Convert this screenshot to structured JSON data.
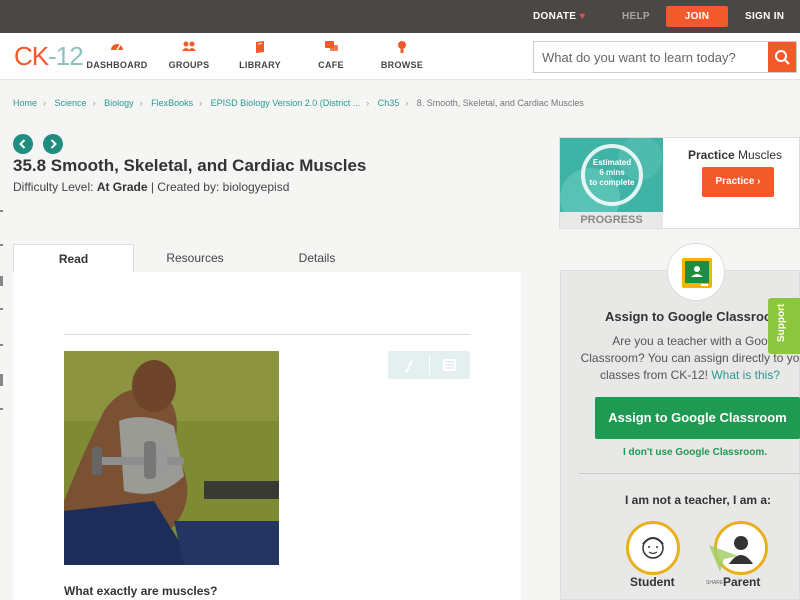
{
  "topbar": {
    "donate": "DONATE",
    "help": "HELP",
    "join": "JOIN",
    "signin": "SIGN IN"
  },
  "logo": {
    "ck": "CK",
    "dash": "-",
    "num": "12"
  },
  "nav": [
    {
      "label": "DASHBOARD",
      "icon": "dashboard-icon"
    },
    {
      "label": "GROUPS",
      "icon": "groups-icon"
    },
    {
      "label": "LIBRARY",
      "icon": "library-icon"
    },
    {
      "label": "CAFE",
      "icon": "cafe-icon"
    },
    {
      "label": "BROWSE",
      "icon": "browse-icon"
    }
  ],
  "search": {
    "placeholder": "What do you want to learn today?"
  },
  "breadcrumb": [
    "Home",
    "Science",
    "Biology",
    "FlexBooks",
    "EPISD Biology Version 2.0 (District ...",
    "Ch35",
    "8. Smooth, Skeletal, and Cardiac Muscles"
  ],
  "article": {
    "title": "35.8 Smooth, Skeletal, and Cardiac Muscles",
    "difficulty_label": "Difficulty Level: ",
    "difficulty": "At Grade",
    "created_sep": " | Created by: ",
    "author": "biologyepisd",
    "question": "What exactly are muscles?"
  },
  "tabs": [
    "Read",
    "Resources",
    "Details"
  ],
  "practice": {
    "est_line1": "Estimated",
    "est_line2": "6 mins",
    "est_line3": "to complete",
    "progress": "PROGRESS",
    "title_bold": "Practice",
    "title_rest": " Muscles",
    "button": "Practice"
  },
  "assign": {
    "title": "Assign to Google Classroo",
    "desc_line1": "Are you a teacher with a Goo",
    "desc_line2": "Classroom? You can assign directly to yo",
    "desc_line3": "classes from CK-12! ",
    "desc_link": "What is this?",
    "button": "Assign to Google Classroom",
    "no_use": "I don't use Google Classroom.",
    "not_teacher": "I am not a teacher, I am a:",
    "student": "Student",
    "parent": "Parent",
    "share": "SHARE"
  },
  "support": "Support",
  "colors": {
    "brand": "#f25a29",
    "teal": "#2a9a8e",
    "green": "#1e9a52",
    "topbar": "#4a4745"
  }
}
